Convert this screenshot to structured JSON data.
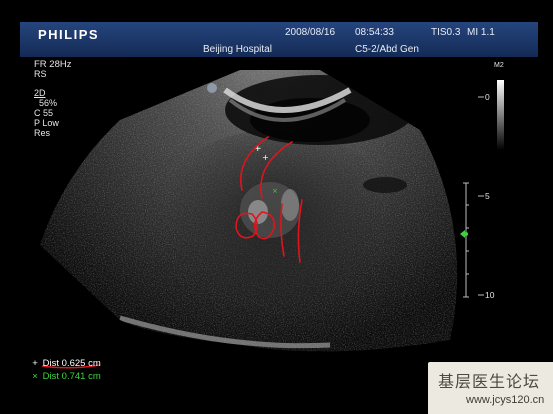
{
  "header": {
    "brand": "PHILIPS",
    "date": "2008/08/16",
    "time": "08:54:33",
    "tis": "TIS0.3",
    "mi": "MI 1.1",
    "hospital": "Beijing Hospital",
    "probe": "C5-2/Abd Gen"
  },
  "params": {
    "frame_rate": "FR 28Hz",
    "rs": "RS",
    "mode": "2D",
    "gain": "56%",
    "compression": "C 55",
    "power": "P Low",
    "res": "Res"
  },
  "scale": {
    "m_label": "M2",
    "ticks": [
      "0",
      "5",
      "10"
    ]
  },
  "measurements": [
    {
      "marker": "+",
      "label": "Dist",
      "value": "0.625 cm",
      "color": "#ffffff"
    },
    {
      "marker": "×",
      "label": "Dist",
      "value": "0.741 cm",
      "color": "#3fd23f"
    }
  ],
  "watermark": {
    "text": "基层医生论坛",
    "url": "www.jcys120.cn"
  },
  "colors": {
    "header_bg": "#1b3566",
    "annotation": "#e0141c",
    "green": "#3fd23f"
  }
}
